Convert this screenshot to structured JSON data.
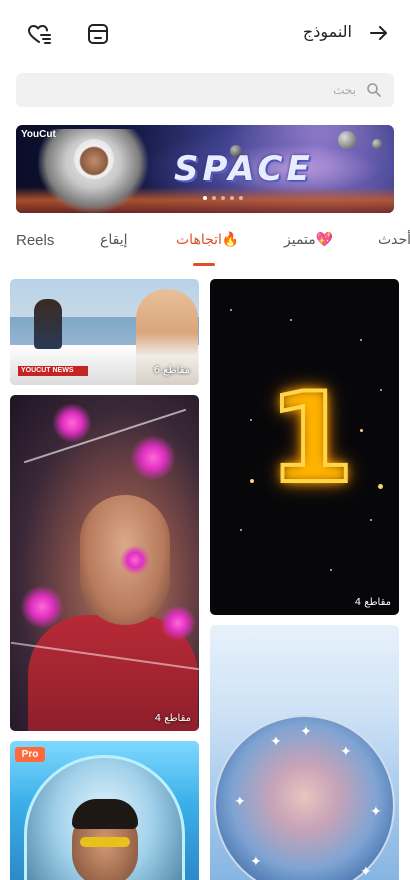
{
  "header": {
    "title": "النموذج",
    "back_icon": "arrow-right-icon",
    "favorites_icon": "heart-list-icon",
    "templates_icon": "template-box-icon"
  },
  "search": {
    "placeholder": "بحث",
    "icon": "search-icon"
  },
  "banner": {
    "brand": "YouCut",
    "headline": "SPACE",
    "slides_count": 5,
    "active_slide": 1
  },
  "tabs": [
    {
      "label": "Reels",
      "active": false
    },
    {
      "label": "إيقاع",
      "active": false
    },
    {
      "label": "اتجاهات🔥",
      "active": true
    },
    {
      "label": "متميز💖",
      "active": false
    },
    {
      "label": "أحدث",
      "active": false
    }
  ],
  "templates": {
    "left": [
      {
        "clips": "6 مقاطع",
        "tag": "YOUCUT NEWS"
      },
      {
        "clips": "4 مقاطع"
      },
      {
        "badge": "Pro"
      }
    ],
    "right": [
      {
        "clips": "4 مقاطع",
        "numeral": "1"
      },
      {}
    ]
  },
  "colors": {
    "accent": "#e0502a",
    "pro_badge": "#ff6a3a",
    "search_bg": "#f1f1f1"
  }
}
